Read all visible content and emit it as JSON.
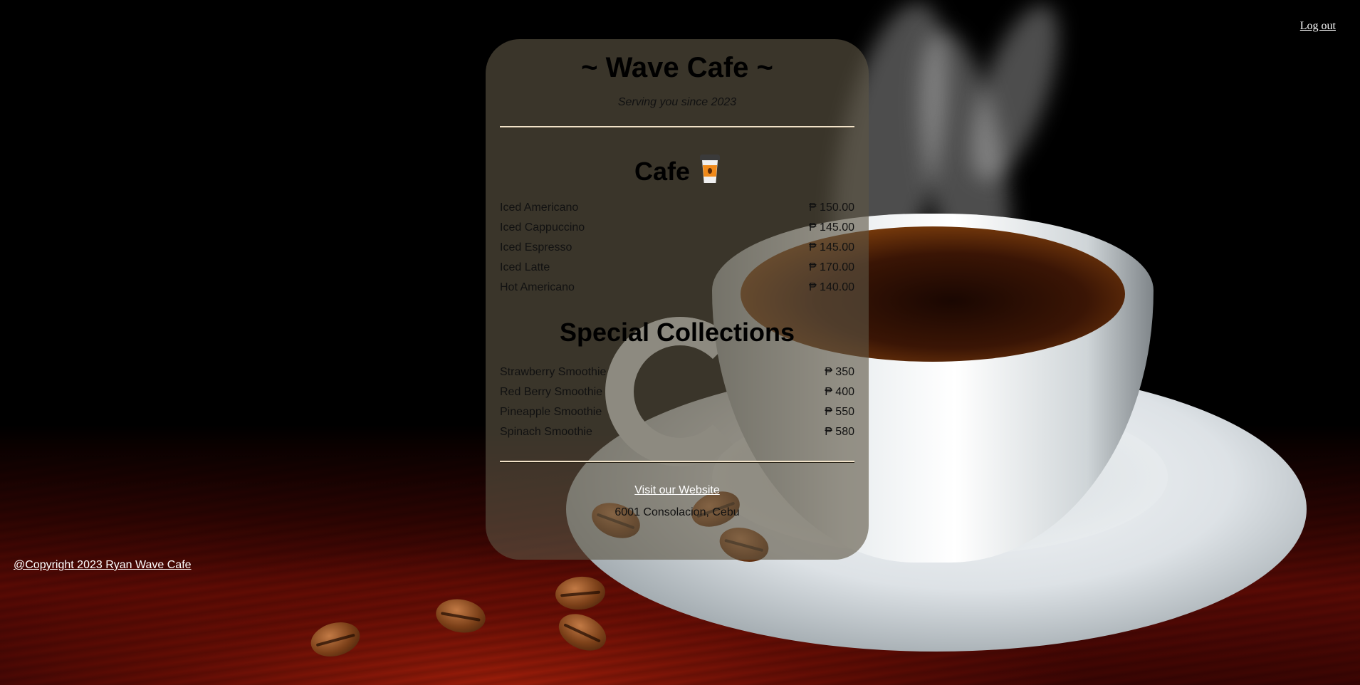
{
  "header": {
    "logout_label": "Log out"
  },
  "menu": {
    "title": "~ Wave Cafe ~",
    "tagline": "Serving you since 2023",
    "sections": [
      {
        "title": "Cafe",
        "icon": "takeout-coffee-cup-icon",
        "items": [
          {
            "name": "Iced Americano",
            "price": "₱ 150.00"
          },
          {
            "name": "Iced Cappuccino",
            "price": "₱ 145.00"
          },
          {
            "name": "Iced Espresso",
            "price": "₱ 145.00"
          },
          {
            "name": "Iced Latte",
            "price": "₱ 170.00"
          },
          {
            "name": "Hot Americano",
            "price": "₱ 140.00"
          }
        ]
      },
      {
        "title": "Special Collections",
        "items": [
          {
            "name": "Strawberry Smoothie",
            "price": "₱ 350"
          },
          {
            "name": "Red Berry Smoothie",
            "price": "₱ 400"
          },
          {
            "name": "Pineapple Smoothie",
            "price": "₱ 550"
          },
          {
            "name": "Spinach Smoothie",
            "price": "₱ 580"
          }
        ]
      }
    ],
    "website_link": "Visit our Website",
    "address": "6001 Consolacion, Cebu"
  },
  "footer": {
    "copyright": "@Copyright 2023 Ryan Wave Cafe"
  },
  "colors": {
    "card_background": "#5e5644",
    "divider": "#f1e2c8",
    "link": "#ffffff"
  }
}
